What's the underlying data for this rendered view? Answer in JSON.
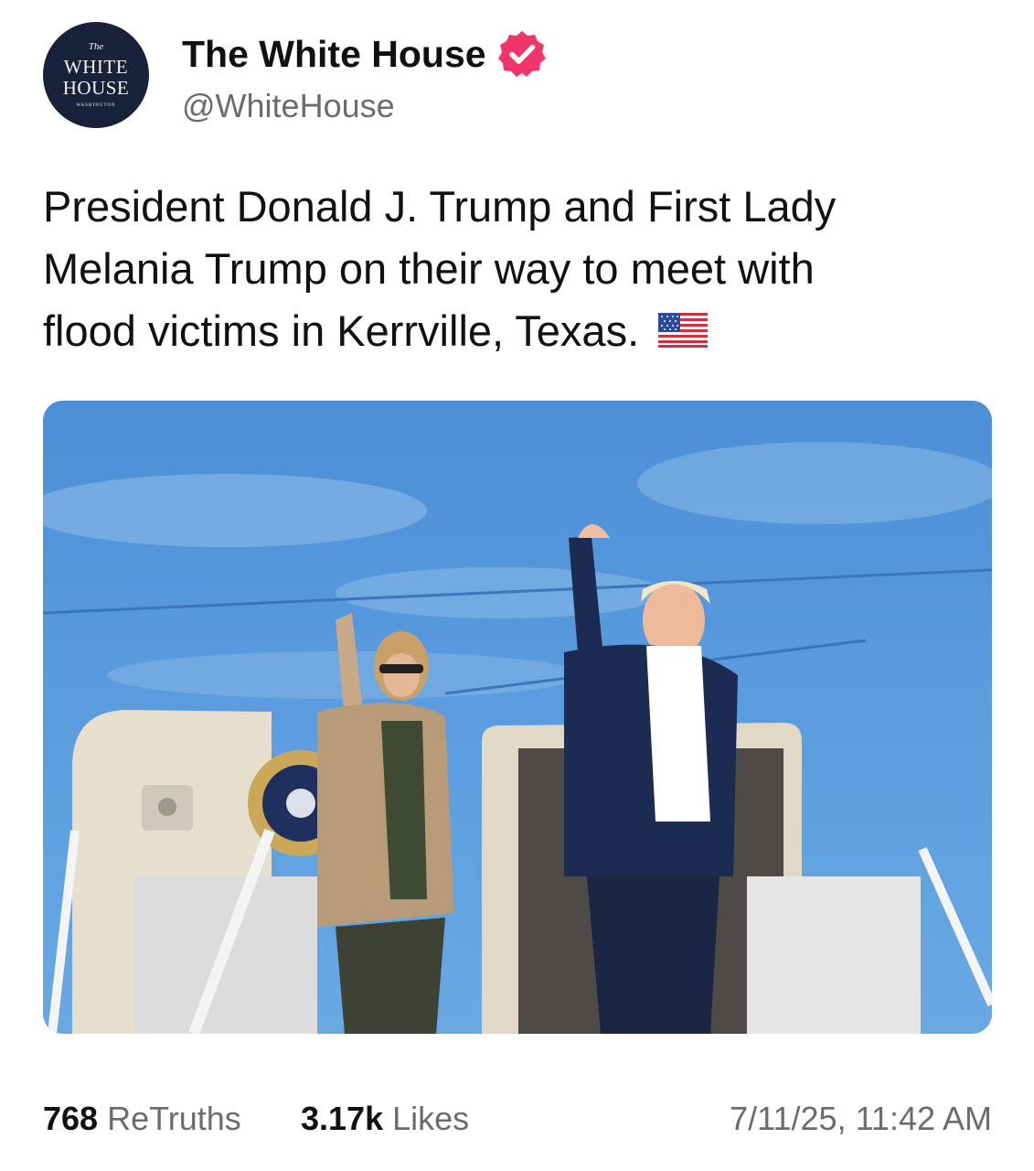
{
  "author": {
    "display_name": "The White House",
    "handle": "@WhiteHouse",
    "verified_icon": "verified-badge-icon",
    "avatar": {
      "line_the": "The",
      "line_white": "WHITE",
      "line_house": "HOUSE",
      "line_small": "WASHINGTON"
    }
  },
  "post": {
    "line1": "President Donald J. Trump and First Lady",
    "line2": "Melania Trump on their way to meet with",
    "line3": "flood victims in Kerrville, Texas.",
    "emoji": "us-flag-icon"
  },
  "stats": {
    "retruths_count": "768",
    "retruths_label": "ReTruths",
    "likes_count": "3.17k",
    "likes_label": "Likes",
    "timestamp": "7/11/25, 11:42 AM"
  },
  "colors": {
    "text": "#111111",
    "muted": "#6b6b70",
    "verified": "#f0356b",
    "avatar_bg": "#17213a",
    "sky": "#5b9ad8"
  }
}
